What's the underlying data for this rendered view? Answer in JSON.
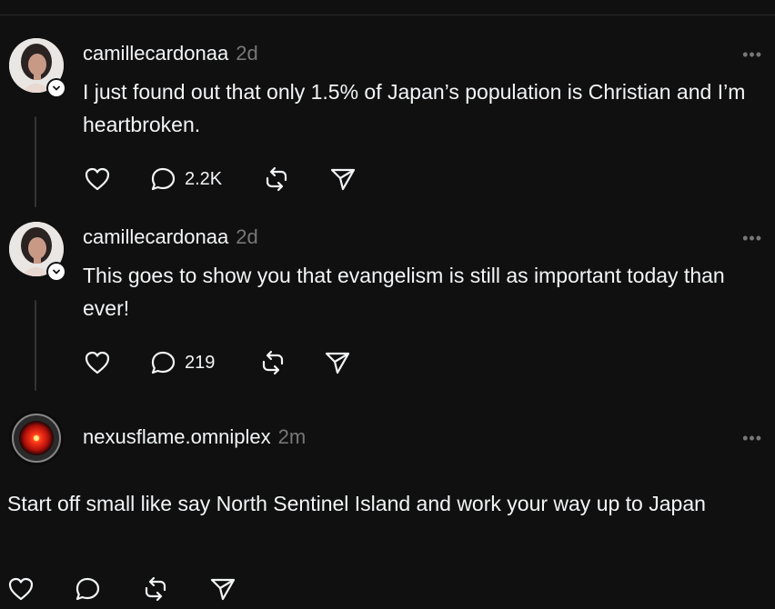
{
  "posts": [
    {
      "username": "camillecardonaa",
      "time": "2d",
      "text": "I just found out that only 1.5% of Japan’s population is Christian and I’m heartbroken.",
      "reply_count": "2.2K"
    },
    {
      "username": "camillecardonaa",
      "time": "2d",
      "text": "This goes to show you that evangelism is still as important today than ever!",
      "reply_count": "219"
    },
    {
      "username": "nexusflame.omniplex",
      "time": "2m",
      "text": "Start off small like say North Sentinel Island and work your way up to Japan",
      "reply_count": ""
    }
  ],
  "more_label": "•••",
  "icons": [
    "heart-icon",
    "comment-icon",
    "repost-icon",
    "share-icon",
    "more-icon",
    "verified-icon"
  ],
  "colors": {
    "background": "#101010",
    "text": "#f3f5f7",
    "muted": "#777777",
    "hal_red": "#e0201a"
  }
}
